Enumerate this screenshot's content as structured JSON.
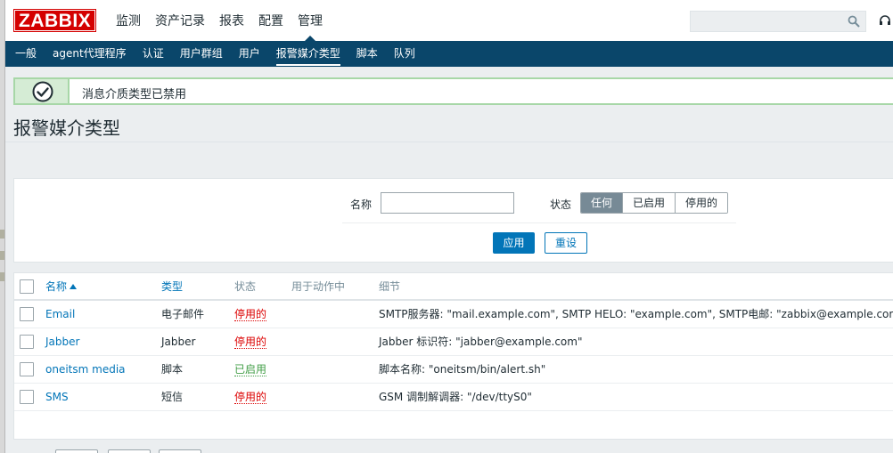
{
  "app": {
    "logo": "ZABBIX"
  },
  "main_nav": [
    {
      "label": "监测"
    },
    {
      "label": "资产记录"
    },
    {
      "label": "报表"
    },
    {
      "label": "配置"
    },
    {
      "label": "管理"
    }
  ],
  "sub_nav": [
    {
      "label": "一般"
    },
    {
      "label": "agent代理程序"
    },
    {
      "label": "认证"
    },
    {
      "label": "用户群组"
    },
    {
      "label": "用户"
    },
    {
      "label": "报警媒介类型"
    },
    {
      "label": "脚本"
    },
    {
      "label": "队列"
    }
  ],
  "message": {
    "text": "消息介质类型已禁用",
    "icon": "check-icon"
  },
  "page": {
    "title": "报警媒介类型"
  },
  "filter": {
    "name_label": "名称",
    "name_value": "",
    "status_label": "状态",
    "status_options": [
      "任何",
      "已启用",
      "停用的"
    ],
    "status_selected": "任何",
    "apply_label": "应用",
    "reset_label": "重设"
  },
  "table": {
    "headers": {
      "name": "名称",
      "type": "类型",
      "status": "状态",
      "used_in_actions": "用于动作中",
      "details": "细节"
    },
    "rows": [
      {
        "name": "Email",
        "type": "电子邮件",
        "status": "停用的",
        "details": "SMTP服务器: \"mail.example.com\", SMTP HELO: \"example.com\", SMTP电邮: \"zabbix@example.com\""
      },
      {
        "name": "Jabber",
        "type": "Jabber",
        "status": "停用的",
        "details": "Jabber 标识符: \"jabber@example.com\""
      },
      {
        "name": "oneitsm media",
        "type": "脚本",
        "status": "已启用",
        "details": "脚本名称: \"oneitsm/bin/alert.sh\""
      },
      {
        "name": "SMS",
        "type": "短信",
        "status": "停用的",
        "details": "GSM 调制解调器: \"/dev/ttyS0\""
      }
    ]
  },
  "colors": {
    "brand_red": "#d40000",
    "nav_blue": "#0a466a",
    "link_blue": "#0275b8",
    "disabled_red": "#dc0000",
    "enabled_green": "#429e47",
    "success_green": "#a7d7a7"
  }
}
